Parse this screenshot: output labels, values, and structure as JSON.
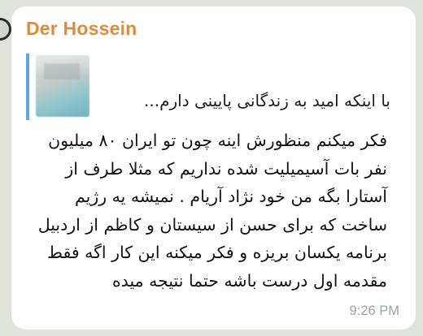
{
  "message": {
    "sender": "Der Hossein",
    "reply_preview": {
      "text": "با اینکه امید به زندگانی پایینی دارم..."
    },
    "body_lines": [
      "فکر میکنم منظورش اینه چون تو ایران ۸۰ میلیون",
      "نفر بات آسیمیلیت شده نداریم که مثلا طرف از",
      "آستارا بگه من خود نژاد آریام . نمیشه یه رژیم",
      "ساخت که برای حسن از سیستان و کاظم از اردبیل",
      "برنامه یکسان بریزه و فکر میکنه این کار اگه فقط",
      "مقدمه اول درست باشه حتما نتیجه میده"
    ],
    "time": "9:26 PM"
  },
  "colors": {
    "sender_name": "#e08a3c",
    "reply_bar": "#5aa8e6",
    "bubble": "#ffffff",
    "timestamp": "#9aa3a8"
  }
}
